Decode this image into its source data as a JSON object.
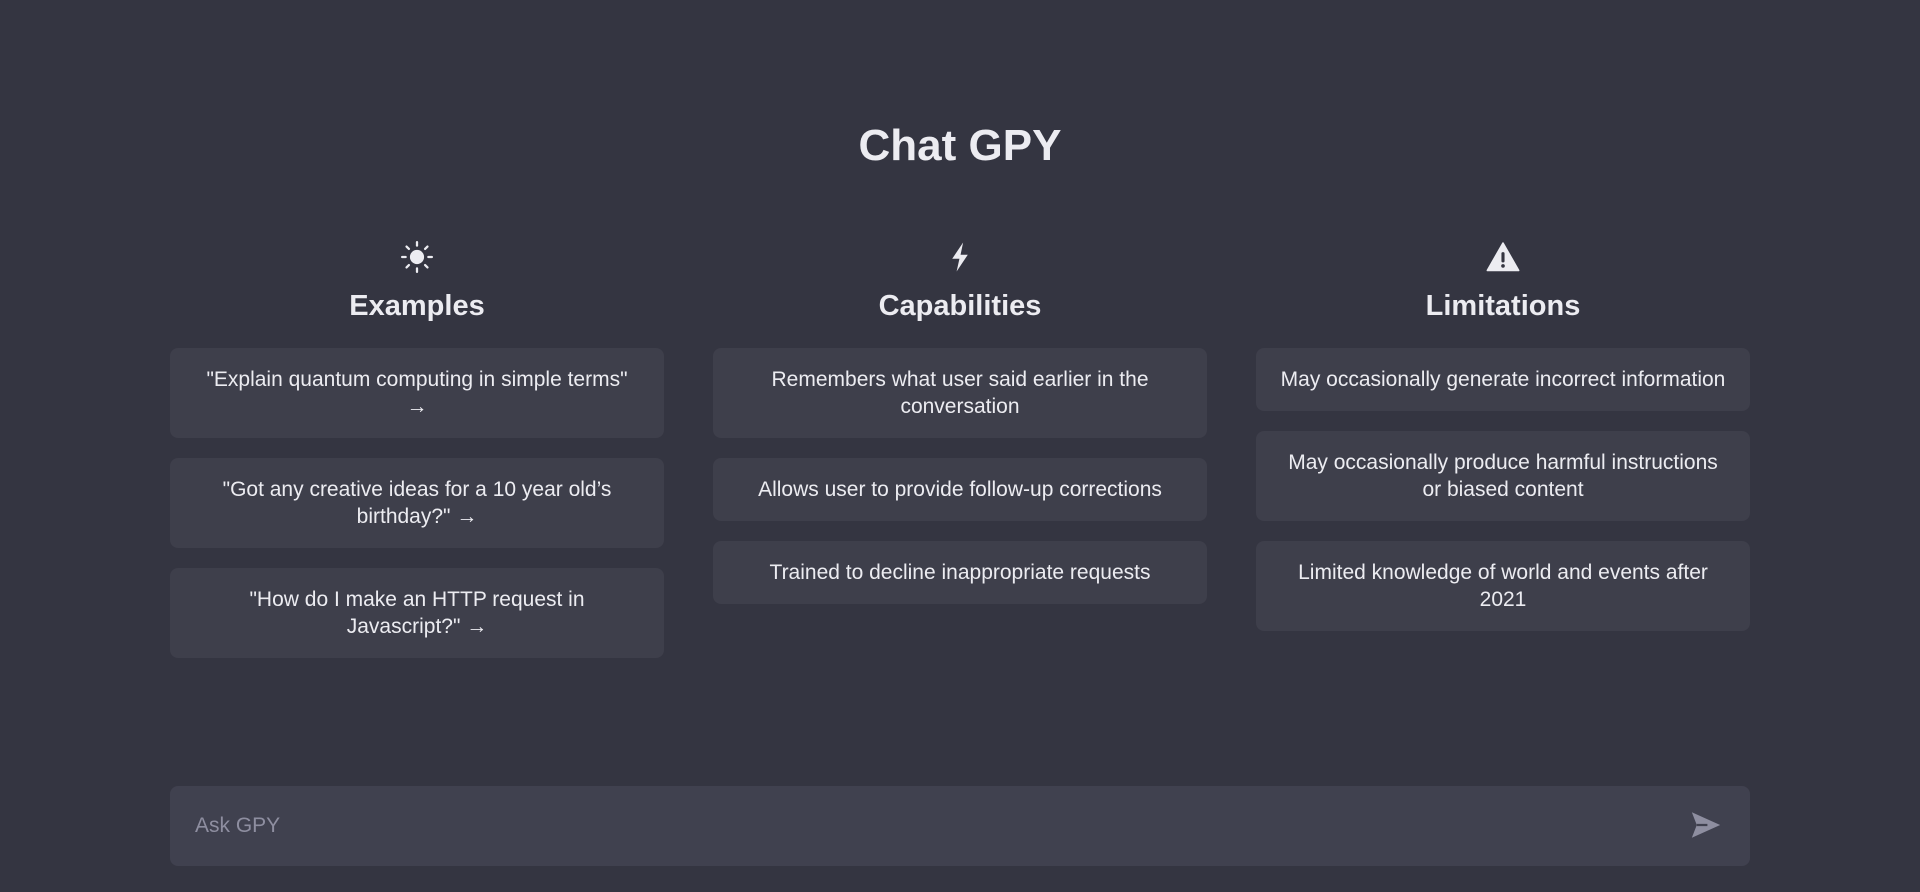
{
  "app": {
    "title": "Chat GPY"
  },
  "columns": [
    {
      "icon": "sun-icon",
      "title": "Examples",
      "items": [
        "\"Explain quantum computing in simple terms\" →",
        "\"Got any creative ideas for a 10 year old’s birthday?\" →",
        "\"How do I make an HTTP request in Javascript?\" →"
      ]
    },
    {
      "icon": "lightning-bolt-icon",
      "title": "Capabilities",
      "items": [
        "Remembers what user said earlier in the conversation",
        "Allows user to provide follow-up corrections",
        "Trained to decline inappropriate requests"
      ]
    },
    {
      "icon": "warning-triangle-icon",
      "title": "Limitations",
      "items": [
        "May occasionally generate incorrect information",
        "May occasionally produce harmful instructions or biased content",
        "Limited knowledge of world and events after 2021"
      ]
    }
  ],
  "input": {
    "placeholder": "Ask GPY",
    "value": "",
    "send_icon": "send-icon"
  },
  "colors": {
    "background": "#343541",
    "card": "#3e3f4b",
    "input": "#40414f",
    "text": "#ececf1",
    "placeholder": "#8e8ea0",
    "send_icon": "#8e8ea0"
  }
}
